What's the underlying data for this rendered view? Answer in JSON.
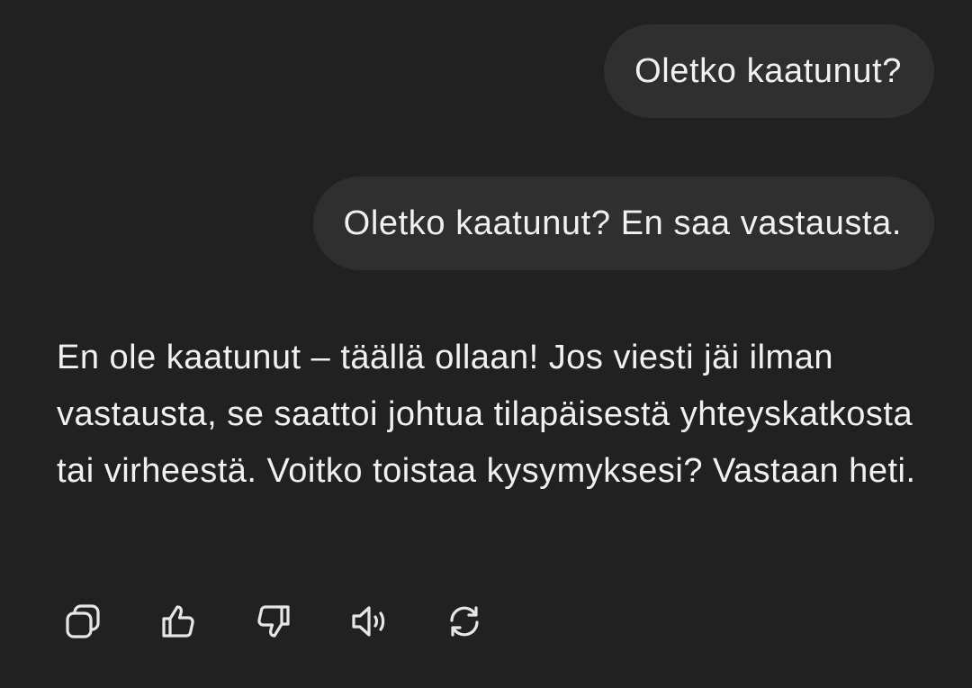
{
  "messages": {
    "user": [
      "Oletko kaatunut?",
      "Oletko kaatunut? En saa vastausta."
    ],
    "assistant": "En ole kaatunut – täällä ollaan! Jos viesti jäi ilman vastausta, se saattoi johtua tilapäisestä yhteyskatkosta tai virheestä. Voitko toistaa kysymyksesi? Vastaan heti."
  },
  "actions": [
    {
      "icon": "copy-icon"
    },
    {
      "icon": "thumbs-up-icon"
    },
    {
      "icon": "thumbs-down-icon"
    },
    {
      "icon": "read-aloud-icon"
    },
    {
      "icon": "regenerate-icon"
    }
  ],
  "colors": {
    "background": "#212121",
    "user_bubble": "#2f2f2f",
    "text": "#f1f1f1",
    "icon": "#e6e6e6"
  }
}
